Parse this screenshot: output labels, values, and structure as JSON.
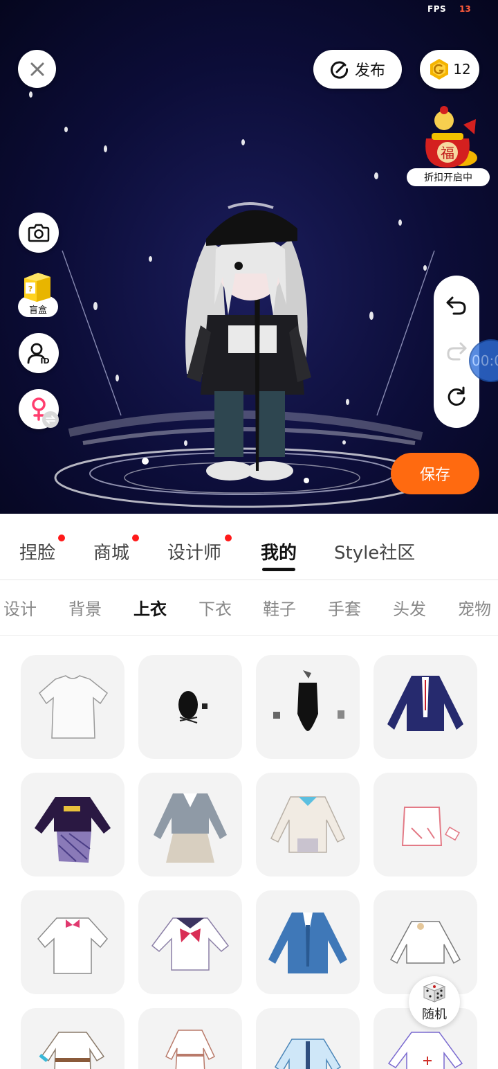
{
  "status": {
    "fps_label": "FPS",
    "fps_value": "13"
  },
  "header": {
    "publish_label": "发布",
    "coin_count": "12",
    "promo_label": "折扣开启中",
    "promo_badge_text": "福"
  },
  "side_tools": {
    "blindbox_label": "盲盒",
    "blindbox_mark": "?"
  },
  "timer": "00:0",
  "save_label": "保存",
  "main_tabs": [
    {
      "label": "捏脸",
      "dot": true
    },
    {
      "label": "商城",
      "dot": true
    },
    {
      "label": "设计师",
      "dot": true
    },
    {
      "label": "我的",
      "dot": false,
      "active": true
    },
    {
      "label": "Style社区",
      "dot": false
    }
  ],
  "sub_tabs": [
    {
      "label": "设计"
    },
    {
      "label": "背景"
    },
    {
      "label": "上衣",
      "active": true
    },
    {
      "label": "下衣"
    },
    {
      "label": "鞋子"
    },
    {
      "label": "手套"
    },
    {
      "label": "头发"
    },
    {
      "label": "宠物"
    }
  ],
  "random_label": "随机",
  "colors": {
    "accent": "#ff6a10",
    "notify_dot": "#ff1a1a",
    "female_icon": "#ff3d6e",
    "coin": "#f5b400",
    "scene_bg": "#0c0d38"
  },
  "icons": [
    "close-icon",
    "publish-icon",
    "coin-icon",
    "camera-icon",
    "blindbox-icon",
    "avatar-id-icon",
    "female-icon",
    "swap-icon",
    "undo-icon",
    "redo-icon",
    "reset-icon",
    "dice-icon"
  ]
}
